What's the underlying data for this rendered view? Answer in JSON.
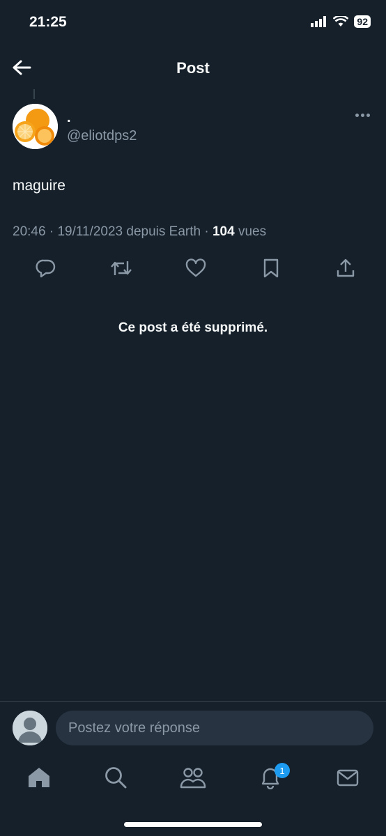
{
  "status_bar": {
    "time": "21:25",
    "battery": "92"
  },
  "header": {
    "title": "Post"
  },
  "post": {
    "display_name": ".",
    "handle": "@eliotdps2",
    "text": "maguire",
    "time": "20:46",
    "date": "19/11/2023",
    "source": "depuis Earth",
    "views_count": "104",
    "views_label": "vues"
  },
  "deleted_notice": "Ce post a été supprimé.",
  "reply": {
    "placeholder": "Postez votre réponse"
  },
  "nav": {
    "notification_badge": "1"
  },
  "colors": {
    "background": "#15202b",
    "muted": "#8b98a5",
    "accent": "#1d9bf0"
  },
  "icons": [
    "back-arrow-icon",
    "more-icon",
    "reply-icon",
    "repost-icon",
    "like-icon",
    "bookmark-icon",
    "share-icon",
    "home-icon",
    "search-icon",
    "communities-icon",
    "notifications-icon",
    "messages-icon"
  ]
}
